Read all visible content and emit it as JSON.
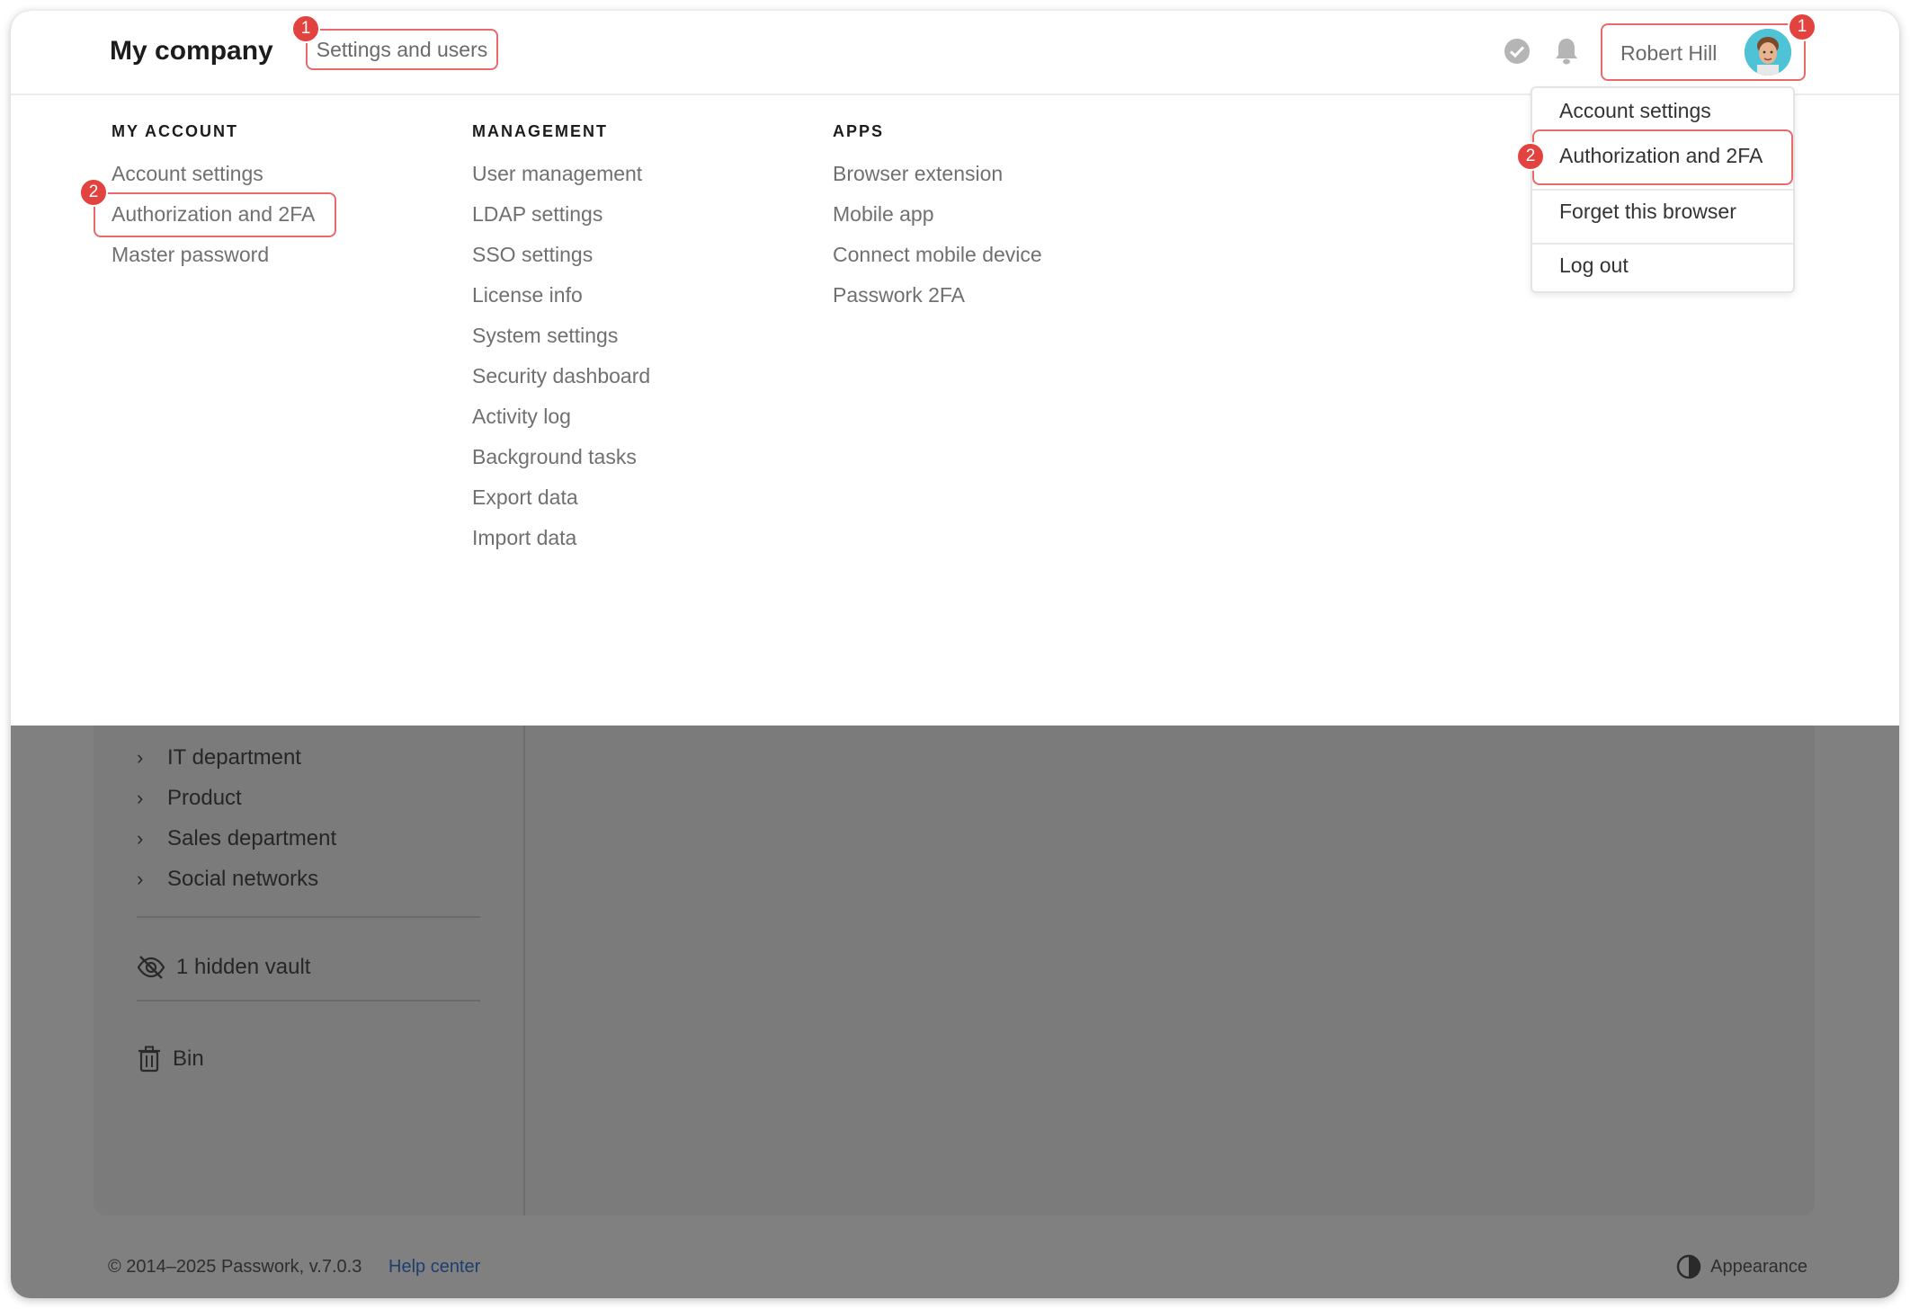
{
  "header": {
    "brand": "My company",
    "settings_tab": "Settings and users",
    "user_name": "Robert Hill"
  },
  "callouts": {
    "one": "1",
    "two": "2"
  },
  "menu": {
    "my_account": {
      "title": "MY ACCOUNT",
      "items": [
        "Account settings",
        "Authorization and 2FA",
        "Master password"
      ]
    },
    "management": {
      "title": "MANAGEMENT",
      "items": [
        "User management",
        "LDAP settings",
        "SSO settings",
        "License info",
        "System settings",
        "Security dashboard",
        "Activity log",
        "Background tasks",
        "Export data",
        "Import data"
      ]
    },
    "apps": {
      "title": "APPS",
      "items": [
        "Browser extension",
        "Mobile app",
        "Connect mobile device",
        "Passwork 2FA"
      ]
    }
  },
  "dropdown": {
    "items": [
      "Account settings",
      "Authorization and 2FA",
      "Forget this browser",
      "Log out"
    ]
  },
  "background": {
    "folders": [
      "IT department",
      "Product",
      "Sales department",
      "Social networks"
    ],
    "hidden_vault": "1 hidden vault",
    "bin": "Bin"
  },
  "footer": {
    "copyright": "© 2014–2025 Passwork, v.7.0.3",
    "help_center": "Help center",
    "appearance": "Appearance"
  },
  "colors": {
    "highlight": "#e86a6a",
    "badge": "#e2433f",
    "overlay": "#808080"
  }
}
